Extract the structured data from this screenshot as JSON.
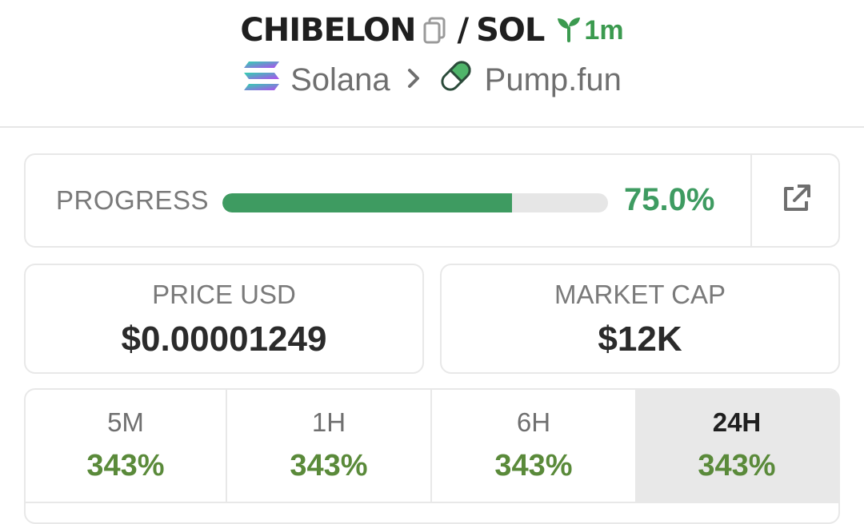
{
  "header": {
    "token_symbol": "CHIBELON",
    "pair_separator": "/",
    "quote_symbol": "SOL",
    "age": "1m",
    "chain": {
      "label": "Solana",
      "icon": "solana-logo-icon"
    },
    "breadcrumb_separator_icon": "chevron-right-icon",
    "dex": {
      "label": "Pump.fun",
      "icon": "pill-icon"
    },
    "copy_icon": "copy-icon",
    "age_icon": "sprout-icon"
  },
  "progress": {
    "label": "PROGRESS",
    "value_text": "75.0%",
    "fraction": 0.75,
    "external_icon": "external-link-icon"
  },
  "stats": {
    "price_label": "PRICE USD",
    "price_value": "$0.00001249",
    "mcap_label": "MARKET CAP",
    "mcap_value": "$12K"
  },
  "timeframes": [
    {
      "label": "5M",
      "value": "343%",
      "active": false
    },
    {
      "label": "1H",
      "value": "343%",
      "active": false
    },
    {
      "label": "6H",
      "value": "343%",
      "active": false
    },
    {
      "label": "24H",
      "value": "343%",
      "active": true
    }
  ],
  "colors": {
    "accent_green": "#3e9b61",
    "change_green": "#5a8a3a",
    "muted_text": "#7a7a7a",
    "border": "#e8e8e8"
  }
}
